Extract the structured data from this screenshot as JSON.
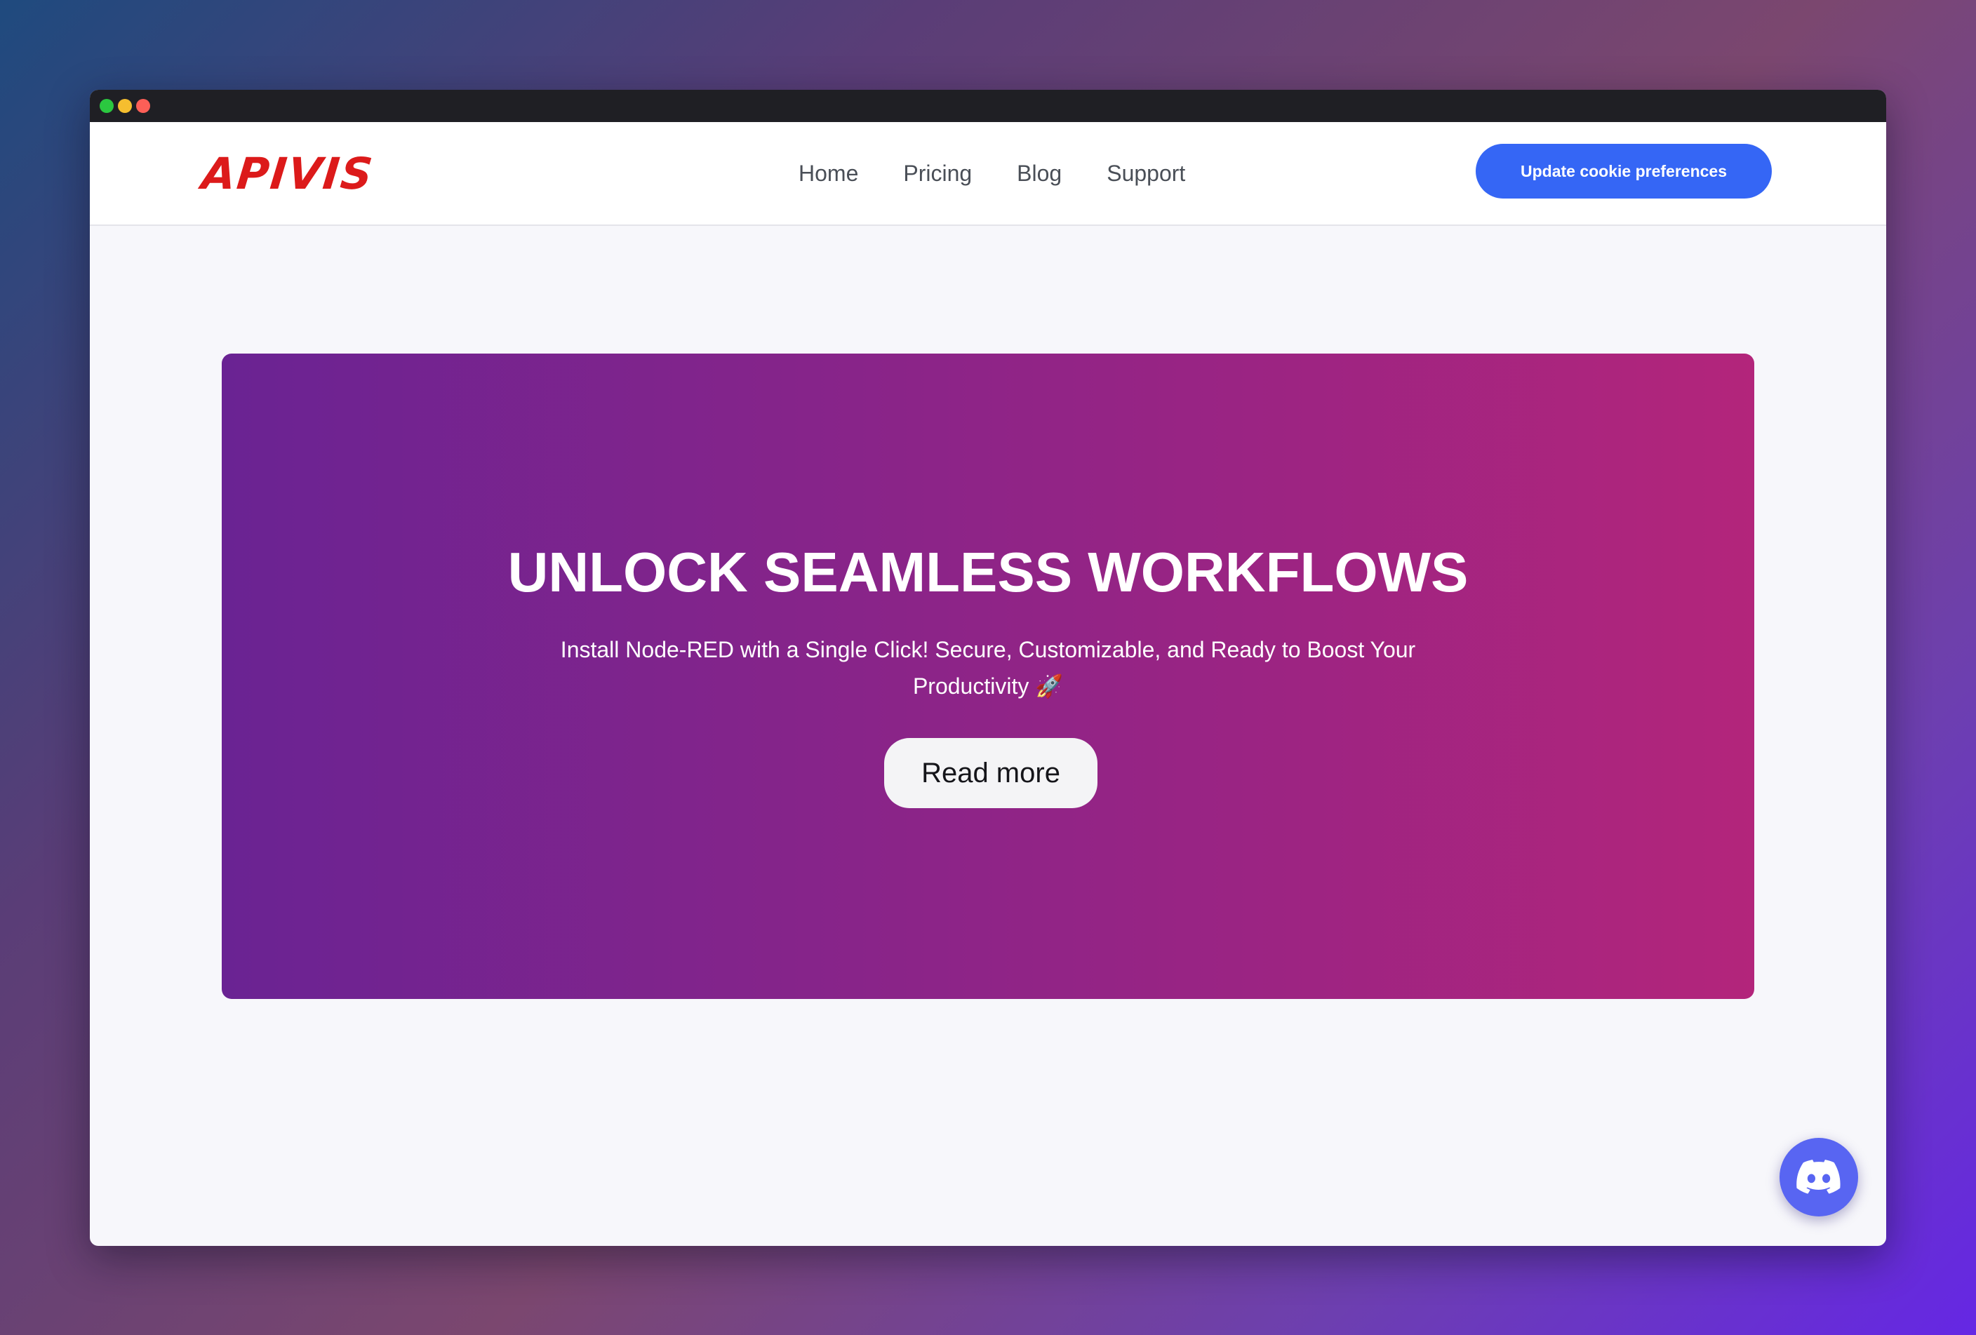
{
  "colors": {
    "desktop_gradient": [
      "#1f4a7e",
      "#7b476f",
      "#6527e4"
    ],
    "titlebar": "#1f1f24",
    "dot_green": "#2bc840",
    "dot_yellow": "#f5be2f",
    "dot_red": "#fd5f57",
    "logo": "#dc1a1a",
    "primary_button": "#3566f5",
    "hero_gradient_start": "#6a2393",
    "hero_gradient_end": "#b3257b",
    "discord": "#5865f2"
  },
  "window": {
    "controls": [
      "green-dot",
      "yellow-dot",
      "red-dot"
    ]
  },
  "navbar": {
    "logo_text": "APIVIS",
    "links": [
      {
        "label": "Home"
      },
      {
        "label": "Pricing"
      },
      {
        "label": "Blog"
      },
      {
        "label": "Support"
      }
    ],
    "cookie_button_label": "Update cookie preferences"
  },
  "hero": {
    "title": "UNLOCK SEAMLESS WORKFLOWS",
    "subtitle": "Install Node-RED with a Single Click! Secure, Customizable, and Ready to Boost Your Productivity 🚀",
    "button_label": "Read more"
  },
  "floating": {
    "icon": "discord-icon"
  }
}
